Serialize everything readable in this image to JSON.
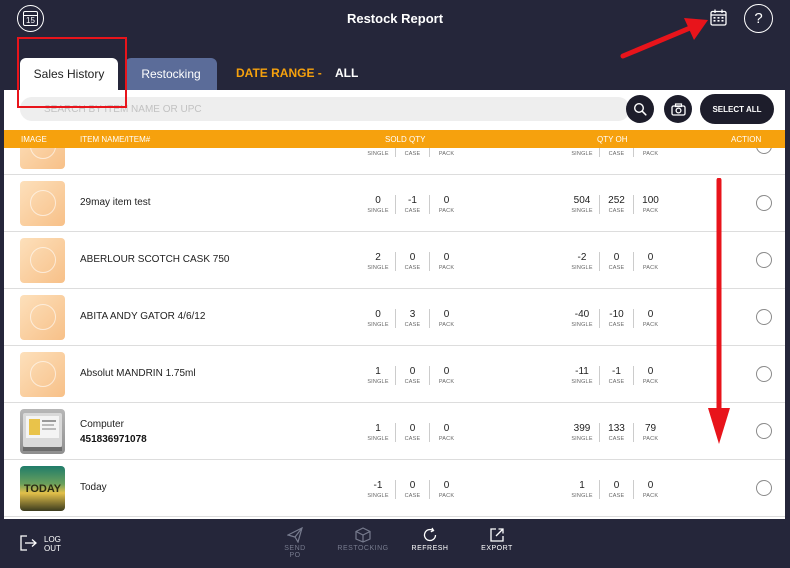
{
  "header": {
    "title": "Restock Report",
    "left_icon_day": "15",
    "help_label": "?"
  },
  "tabs": {
    "sales_history": "Sales History",
    "restocking": "Restocking",
    "date_range_label": "DATE RANGE -",
    "date_range_value": "ALL"
  },
  "search": {
    "placeholder": "SEARCH BY ITEM NAME OR UPC",
    "select_all": "SELECT ALL"
  },
  "columns": {
    "image": "IMAGE",
    "item_name": "ITEM NAME/ITEM#",
    "sold_qty": "SOLD QTY",
    "qty_oh": "QTY OH",
    "action": "ACTION"
  },
  "unit_labels": {
    "single": "SINGLE",
    "case": "CASE",
    "pack": "PACK"
  },
  "rows": [
    {
      "name": "",
      "upc": "",
      "sold": [
        "",
        "",
        ""
      ],
      "oh": [
        "",
        "",
        ""
      ]
    },
    {
      "name": "29may item test",
      "upc": "",
      "sold": [
        "0",
        "-1",
        "0"
      ],
      "oh": [
        "504",
        "252",
        "100"
      ]
    },
    {
      "name": "ABERLOUR SCOTCH  CASK 750",
      "upc": "",
      "sold": [
        "2",
        "0",
        "0"
      ],
      "oh": [
        "-2",
        "0",
        "0"
      ]
    },
    {
      "name": "ABITA ANDY GATOR 4/6/12",
      "upc": "",
      "sold": [
        "0",
        "3",
        "0"
      ],
      "oh": [
        "-40",
        "-10",
        "0"
      ]
    },
    {
      "name": "Absolut MANDRIN 1.75ml",
      "upc": "",
      "sold": [
        "1",
        "0",
        "0"
      ],
      "oh": [
        "-11",
        "-1",
        "0"
      ]
    },
    {
      "name": "Computer",
      "upc": "451836971078",
      "sold": [
        "1",
        "0",
        "0"
      ],
      "oh": [
        "399",
        "133",
        "79"
      ]
    },
    {
      "name": "Today",
      "upc": "",
      "sold": [
        "-1",
        "0",
        "0"
      ],
      "oh": [
        "1",
        "0",
        "0"
      ],
      "image_text": "TODAY"
    }
  ],
  "bottom": {
    "logout": "LOG OUT",
    "send_po": "SEND PO",
    "restocking": "RESTOCKING",
    "refresh": "REFRESH",
    "export": "EXPORT"
  },
  "colors": {
    "bar": "#25263a",
    "accent": "#f6a10d",
    "tab_inactive": "#5b6c99",
    "annotation": "#e8141b"
  }
}
